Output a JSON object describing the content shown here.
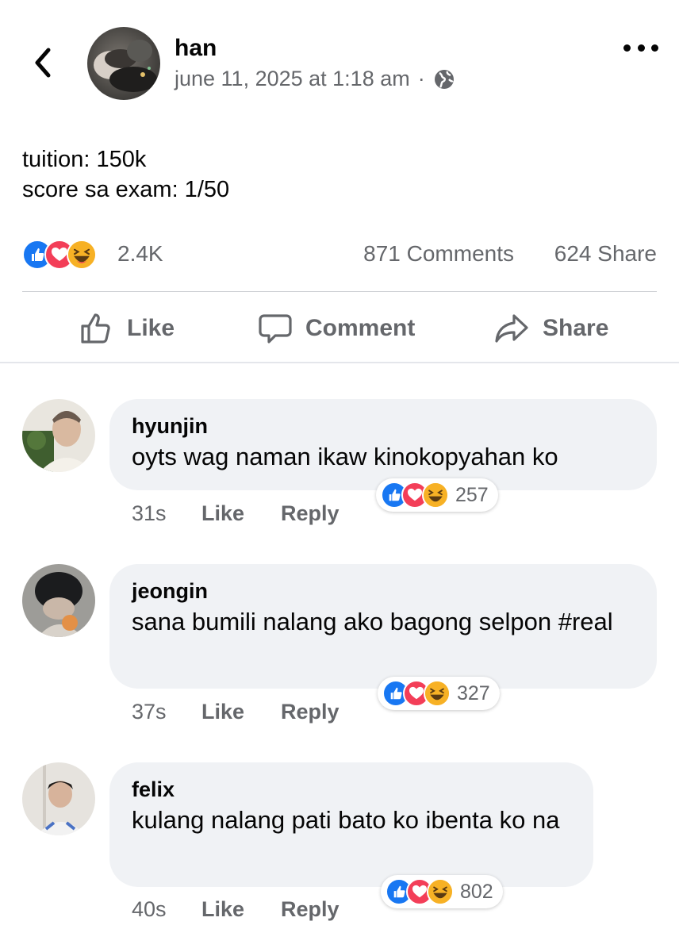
{
  "post": {
    "author": "han",
    "timestamp": "june 11, 2025 at 1:18 am",
    "separator": "·",
    "privacy_icon": "globe-icon",
    "lines": [
      "tuition: 150k",
      "score sa exam: 1/50"
    ]
  },
  "stats": {
    "reactions": [
      "like",
      "love",
      "haha"
    ],
    "reaction_count": "2.4K",
    "comments": "871 Comments",
    "shares": "624 Share"
  },
  "actions": {
    "like": "Like",
    "comment": "Comment",
    "share": "Share"
  },
  "comments": [
    {
      "name": "hyunjin",
      "text": "oyts wag naman ikaw kinokopyahan ko",
      "reactions": 257,
      "time": "31s",
      "like": "Like",
      "reply": "Reply"
    },
    {
      "name": "jeongin",
      "text": "sana bumili nalang ako bagong selpon #real",
      "reactions": 327,
      "time": "37s",
      "like": "Like",
      "reply": "Reply"
    },
    {
      "name": "felix",
      "text": "kulang nalang pati bato ko ibenta ko na",
      "reactions": 802,
      "time": "40s",
      "like": "Like",
      "reply": "Reply"
    }
  ],
  "colors": {
    "like_blue": "#1877f2",
    "love_red": "#f33e58",
    "haha_yellow": "#f7b125",
    "muted_text": "#65676b",
    "bubble_bg": "#f0f2f5"
  }
}
